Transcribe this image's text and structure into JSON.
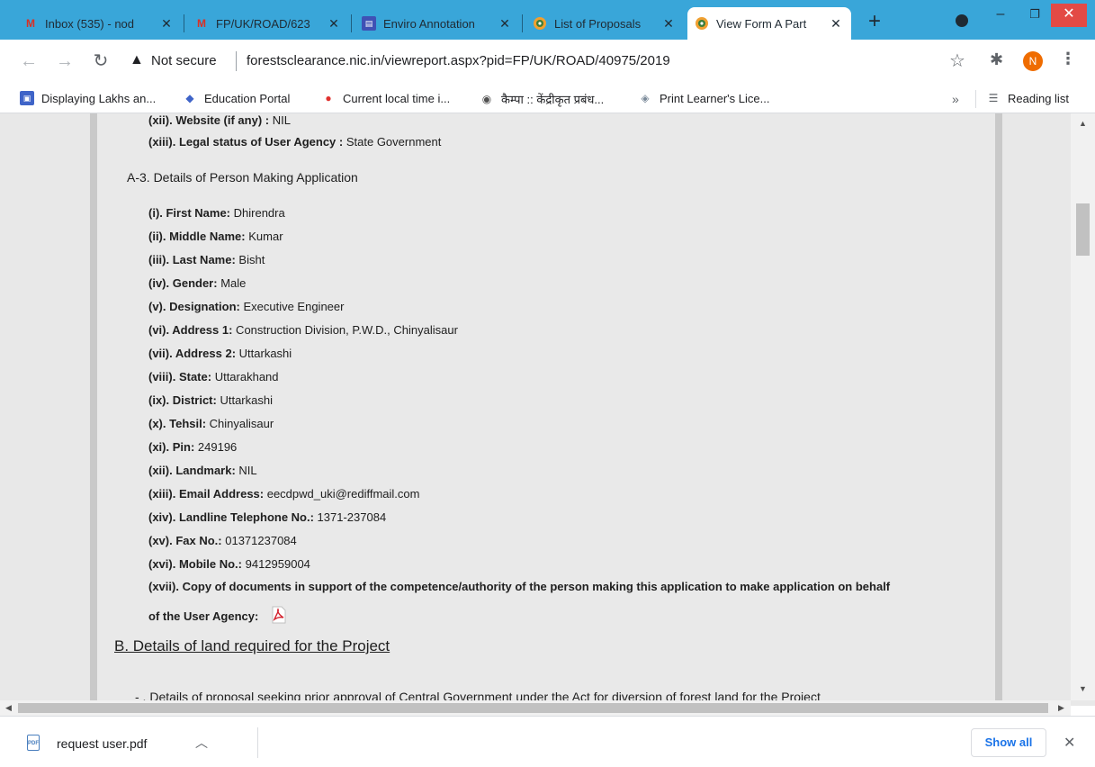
{
  "tabs": [
    {
      "title": "Inbox (535) - nod",
      "icon": "gmail-icon"
    },
    {
      "title": "FP/UK/ROAD/623",
      "icon": "gmail-icon"
    },
    {
      "title": "Enviro Annotation",
      "icon": "forms-icon"
    },
    {
      "title": "List of Proposals",
      "icon": "emblem-icon"
    },
    {
      "title": "View Form A Part",
      "icon": "emblem-icon",
      "active": true
    }
  ],
  "address": {
    "security_label": "Not secure",
    "url": "forestsclearance.nic.in/viewreport.aspx?pid=FP/UK/ROAD/40975/2019"
  },
  "profile_initial": "N",
  "bookmarks": [
    "Displaying Lakhs an...",
    "Education Portal",
    "Current local time i...",
    "कैम्पा :: केंद्रीकृत प्रबंध...",
    "Print Learner's Lice..."
  ],
  "reading_list": "Reading list",
  "chevron_more": "»",
  "content": {
    "top_lines": [
      {
        "label": "(xii). Website (if any) :",
        "value": " NIL"
      },
      {
        "label": "(xiii). Legal status of User Agency :",
        "value": " State Government"
      }
    ],
    "section_a3": "A-3. Details of Person Making Application",
    "fields": [
      {
        "label": "(i). First Name:",
        "value": " Dhirendra"
      },
      {
        "label": "(ii). Middle Name:",
        "value": " Kumar"
      },
      {
        "label": "(iii). Last Name:",
        "value": " Bisht"
      },
      {
        "label": "(iv). Gender:",
        "value": " Male"
      },
      {
        "label": "(v). Designation:",
        "value": " Executive Engineer"
      },
      {
        "label": "(vi). Address 1:",
        "value": " Construction Division, P.W.D., Chinyalisaur"
      },
      {
        "label": "(vii). Address 2:",
        "value": " Uttarkashi"
      },
      {
        "label": "(viii). State:",
        "value": " Uttarakhand"
      },
      {
        "label": "(ix). District:",
        "value": " Uttarkashi"
      },
      {
        "label": "(x). Tehsil:",
        "value": " Chinyalisaur"
      },
      {
        "label": "(xi). Pin:",
        "value": " 249196"
      },
      {
        "label": "(xii). Landmark:",
        "value": " NIL"
      },
      {
        "label": "(xiii). Email Address:",
        "value": " eecdpwd_uki@rediffmail.com"
      },
      {
        "label": "(xiv). Landline Telephone No.:",
        "value": " 1371-237084"
      },
      {
        "label": "(xv). Fax No.:",
        "value": " 01371237084"
      },
      {
        "label": "(xvi). Mobile No.:",
        "value": " 9412959004"
      }
    ],
    "xvii_line1": "(xvii). Copy of documents in support of the competence/authority of the person making this application to make application on behalf",
    "xvii_line2": "of the User Agency:",
    "section_b": "B.  Details of land required for the Project",
    "cut_line": "Details of proposal seeking prior approval of Central Government under the Act for diversion of forest land for the Project"
  },
  "download": {
    "filename": "request user.pdf",
    "show_all": "Show all"
  }
}
